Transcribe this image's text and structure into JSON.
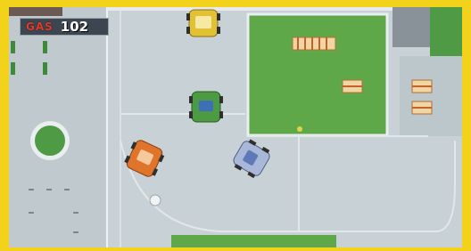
{
  "hud": {
    "gas_label": "GAS",
    "gas_value": "102"
  },
  "colors": {
    "frame": "#f2d21a",
    "pavement": "#c8d2d6",
    "grass": "#5fa84a",
    "hud_bg": "#3b4650",
    "gas_label": "#e33a2c",
    "player_car": "#e0742a",
    "car_yellow": "#e2c233",
    "car_green": "#4d9a44",
    "car_blue": "#a9b8d8"
  },
  "entities": {
    "cars": [
      "player-car-orange",
      "car-yellow",
      "car-green",
      "car-blue"
    ],
    "objects": [
      "grass-lot",
      "roundabout-island",
      "house-a",
      "house-b",
      "house-c",
      "house-d",
      "house-row",
      "hydrant"
    ]
  }
}
